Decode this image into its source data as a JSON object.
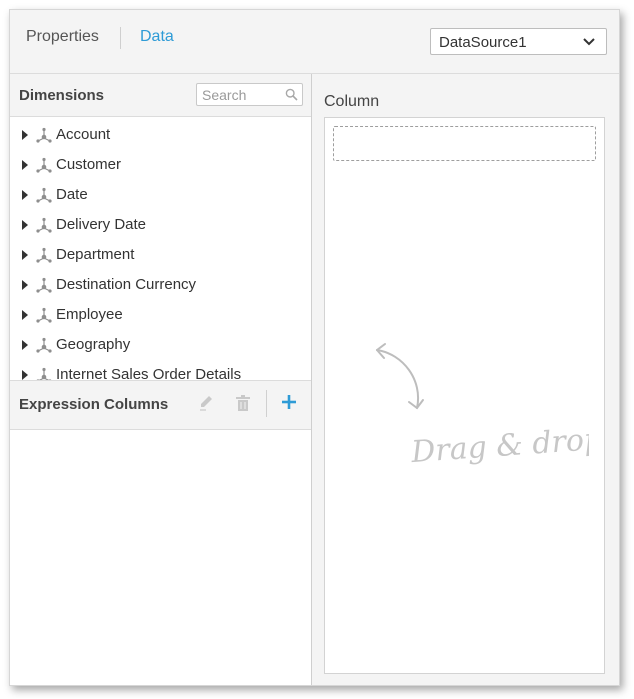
{
  "header": {
    "tabs": [
      {
        "label": "Properties"
      },
      {
        "label": "Data"
      }
    ],
    "active_tab": "Data",
    "datasource": {
      "value": "DataSource1",
      "icon": "chevron-down-icon"
    }
  },
  "dimensions": {
    "title": "Dimensions",
    "search": {
      "placeholder": "Search",
      "icon": "search-icon"
    },
    "items": [
      {
        "label": "Account"
      },
      {
        "label": "Customer"
      },
      {
        "label": "Date"
      },
      {
        "label": "Delivery Date"
      },
      {
        "label": "Department"
      },
      {
        "label": "Destination Currency"
      },
      {
        "label": "Employee"
      },
      {
        "label": "Geography"
      },
      {
        "label": "Internet Sales Order Details"
      }
    ]
  },
  "expression_columns": {
    "title": "Expression Columns",
    "icons": [
      "pencil-icon",
      "trash-icon",
      "plus-icon"
    ]
  },
  "column_panel": {
    "title": "Column",
    "hint": "Drag & drop"
  },
  "colors": {
    "accent": "#2e9bd6",
    "panel_bg": "#f4f4f4",
    "border": "#dcdcdc"
  }
}
